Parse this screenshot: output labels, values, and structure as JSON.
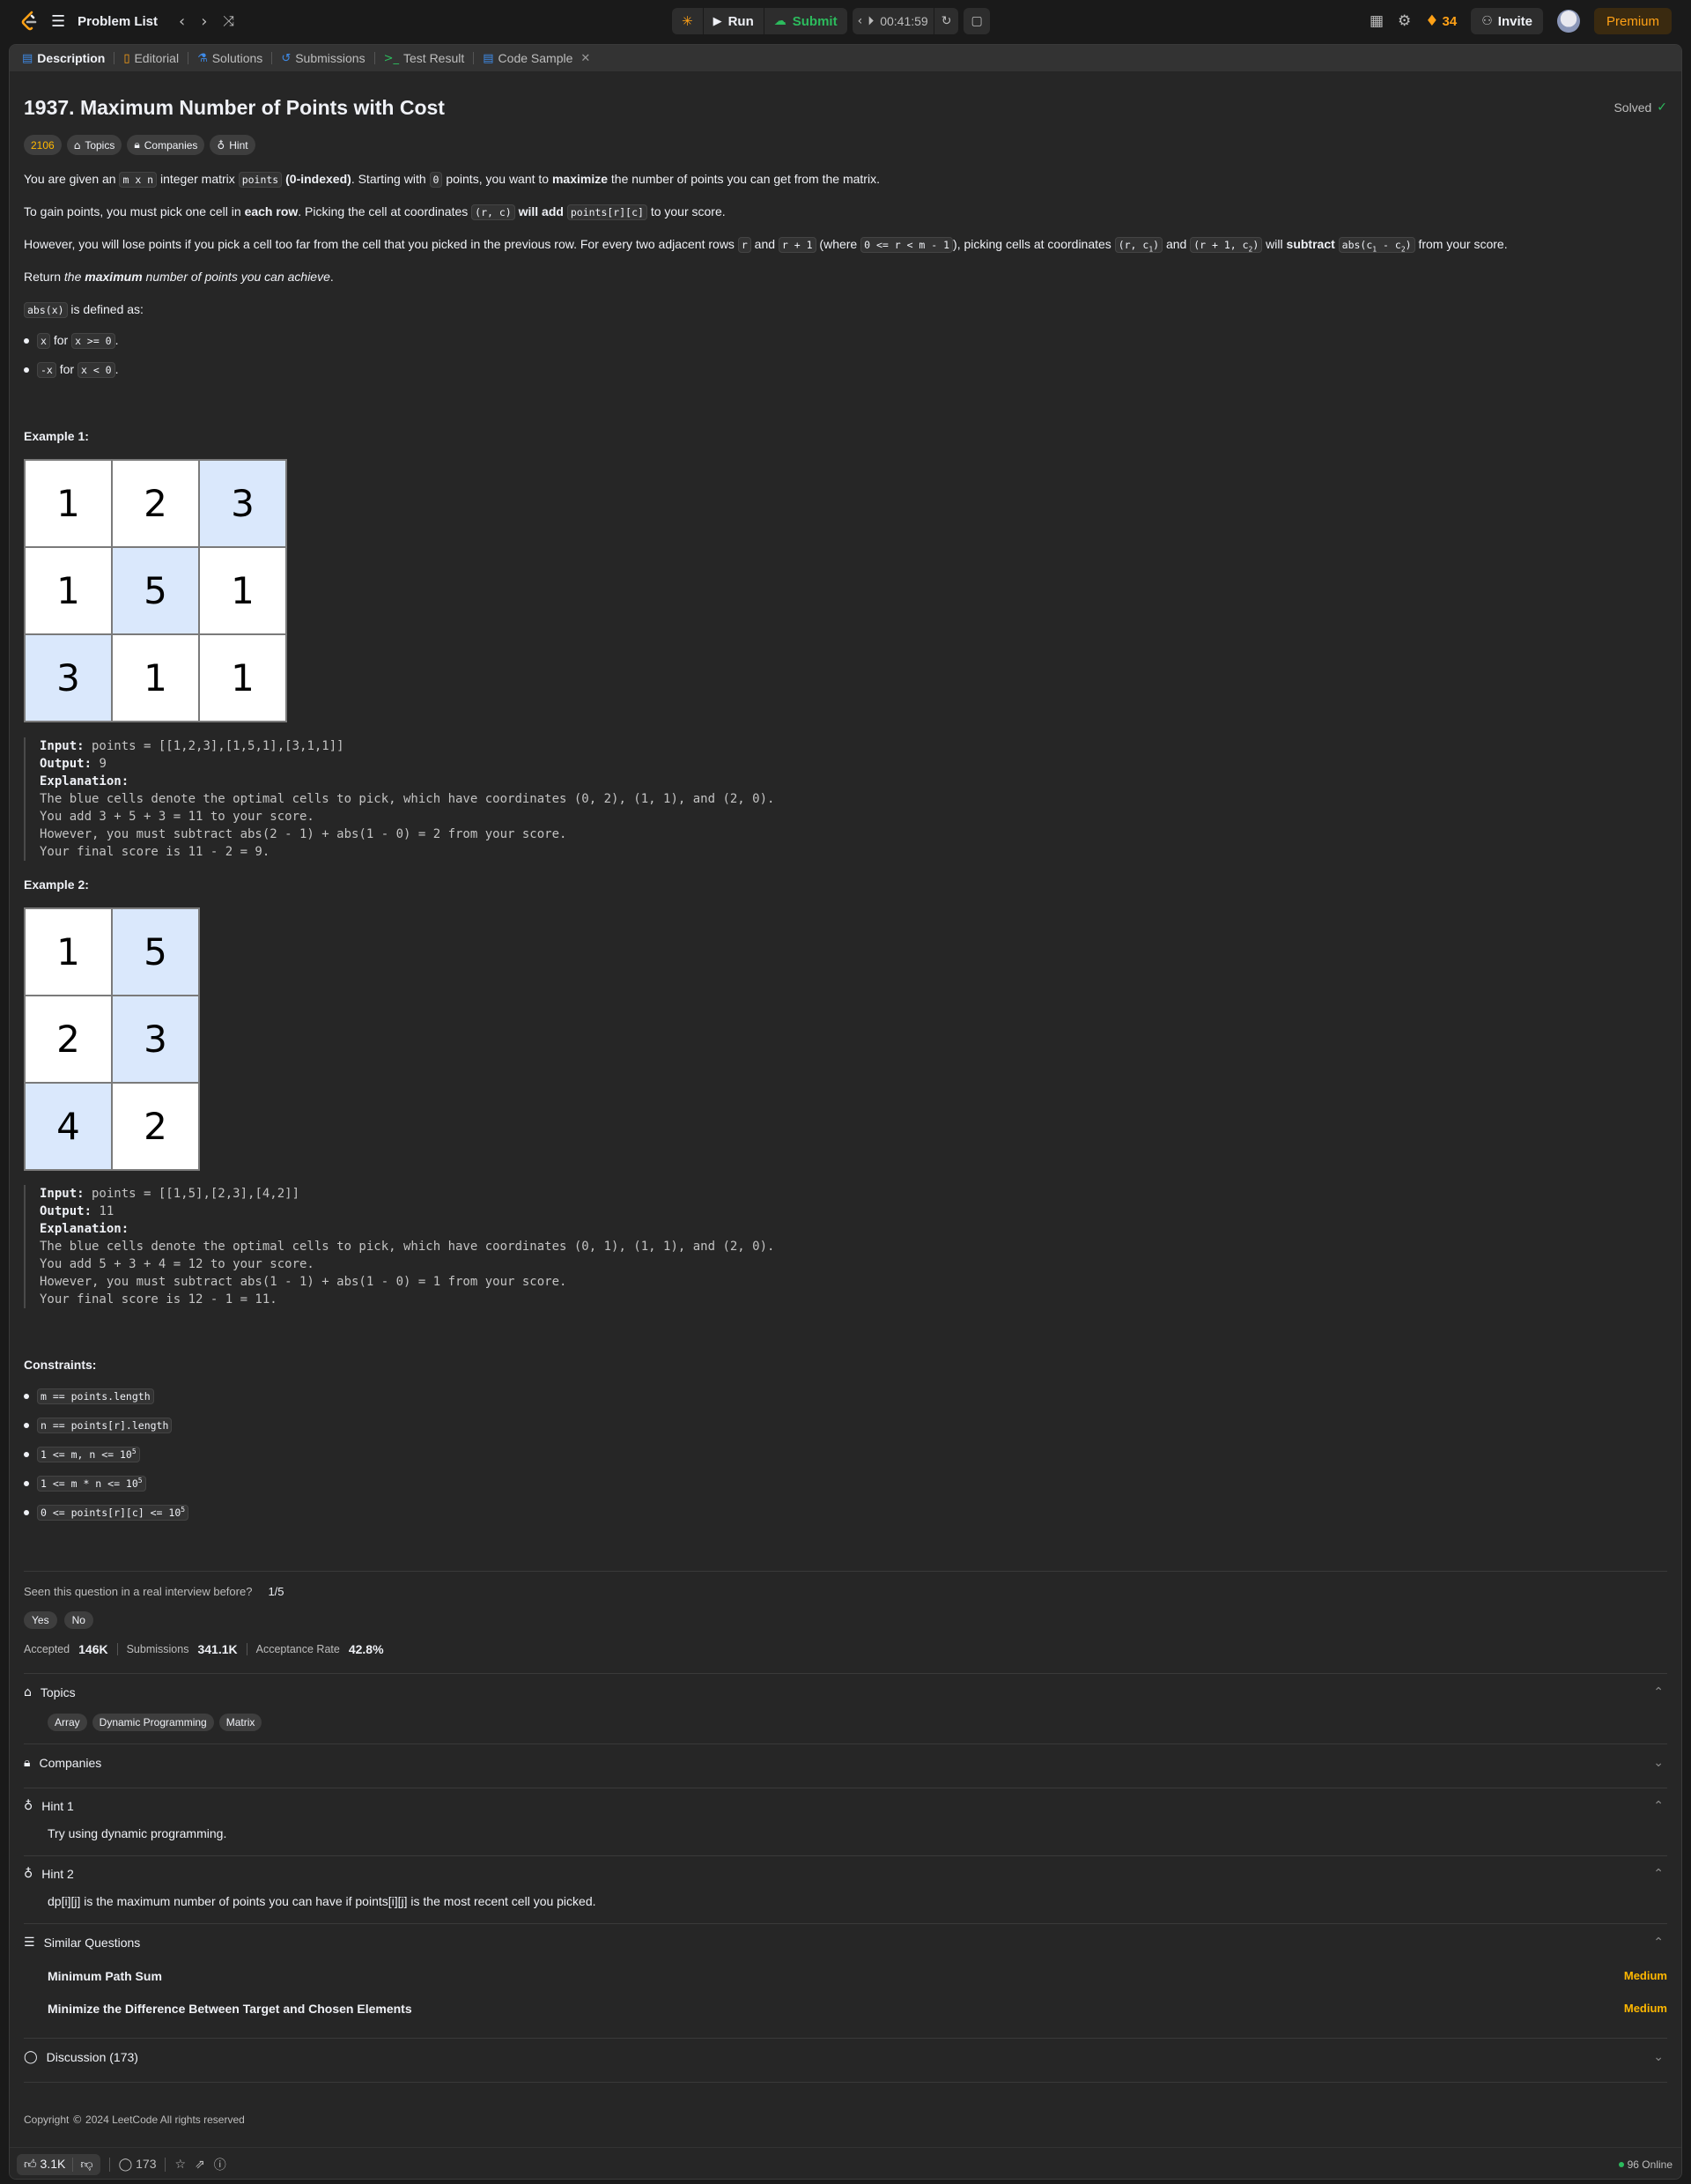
{
  "topbar": {
    "problem_list_label": "Problem List",
    "run_label": "Run",
    "submit_label": "Submit",
    "timer": "00:41:59",
    "streak": "34",
    "invite_label": "Invite",
    "premium_label": "Premium"
  },
  "tabs": [
    {
      "label": "Description"
    },
    {
      "label": "Editorial"
    },
    {
      "label": "Solutions"
    },
    {
      "label": "Submissions"
    },
    {
      "label": "Test Result"
    },
    {
      "label": "Code Sample"
    }
  ],
  "problem": {
    "title": "1937. Maximum Number of Points with Cost",
    "status": "Solved",
    "rating": "2106",
    "chip_topics": "Topics",
    "chip_companies": "Companies",
    "chip_hint": "Hint"
  },
  "desc": {
    "p1_a": "You are given an ",
    "p1_code1": "m x n",
    "p1_b": " integer matrix ",
    "p1_code2": "points",
    "p1_c": " ",
    "p1_bold1": "(0-indexed)",
    "p1_d": ". Starting with ",
    "p1_code3": "0",
    "p1_e": " points, you want to ",
    "p1_bold2": "maximize",
    "p1_f": " the number of points you can get from the matrix.",
    "p2_a": "To gain points, you must pick one cell in ",
    "p2_bold1": "each row",
    "p2_b": ". Picking the cell at coordinates ",
    "p2_code1": "(r, c)",
    "p2_c": " ",
    "p2_bold2": "will add",
    "p2_d": " ",
    "p2_code2": "points[r][c]",
    "p2_e": " to your score.",
    "p3_a": "However, you will lose points if you pick a cell too far from the cell that you picked in the previous row. For every two adjacent rows ",
    "p3_code1": "r",
    "p3_b": " and ",
    "p3_code2": "r + 1",
    "p3_c": " (where ",
    "p3_code3": "0 <= r < m - 1",
    "p3_d": "), picking cells at coordinates ",
    "p3_code4": "(r, c",
    "p3_code4_sub": "1",
    "p3_code4_end": ")",
    "p3_e": " and ",
    "p3_code5": "(r + 1, c",
    "p3_code5_sub": "2",
    "p3_code5_end": ")",
    "p3_f": " will ",
    "p3_bold": "subtract",
    "p3_g": " ",
    "p3_code6": "abs(c",
    "p3_code6_sub1": "1",
    "p3_code6_mid": " - c",
    "p3_code6_sub2": "2",
    "p3_code6_end": ")",
    "p3_h": " from your score.",
    "p4_a": "Return ",
    "p4_i1": "the ",
    "p4_bi": "maximum",
    "p4_i2": " number of points you can achieve",
    "p4_b": ".",
    "p5_code": "abs(x)",
    "p5_a": " is defined as:",
    "b1_code1": "x",
    "b1_a": " for ",
    "b1_code2": "x >= 0",
    "b1_b": ".",
    "b2_code1": "-x",
    "b2_a": " for ",
    "b2_code2": "x < 0",
    "b2_b": "."
  },
  "example1": {
    "heading": "Example 1:",
    "grid": [
      [
        "1",
        "2",
        "3"
      ],
      [
        "1",
        "5",
        "1"
      ],
      [
        "3",
        "1",
        "1"
      ]
    ],
    "input_label": "Input:",
    "input_val": " points = [[1,2,3],[1,5,1],[3,1,1]]",
    "output_label": "Output:",
    "output_val": " 9",
    "expl_label": "Explanation:",
    "expl_lines": [
      "The blue cells denote the optimal cells to pick, which have coordinates (0, 2), (1, 1), and (2, 0).",
      "You add 3 + 5 + 3 = 11 to your score.",
      "However, you must subtract abs(2 - 1) + abs(1 - 0) = 2 from your score.",
      "Your final score is 11 - 2 = 9."
    ]
  },
  "example2": {
    "heading": "Example 2:",
    "grid": [
      [
        "1",
        "5"
      ],
      [
        "2",
        "3"
      ],
      [
        "4",
        "2"
      ]
    ],
    "input_label": "Input:",
    "input_val": " points = [[1,5],[2,3],[4,2]]",
    "output_label": "Output:",
    "output_val": " 11",
    "expl_label": "Explanation:",
    "expl_lines": [
      "The blue cells denote the optimal cells to pick, which have coordinates (0, 1), (1, 1), and (2, 0).",
      "You add 5 + 3 + 4 = 12 to your score.",
      "However, you must subtract abs(1 - 1) + abs(1 - 0) = 1 from your score.",
      "Your final score is 12 - 1 = 11."
    ]
  },
  "constraints": {
    "heading": "Constraints:",
    "c1": "m == points.length",
    "c2": "n == points[r].length",
    "c3": "1 <= m, n <= 10",
    "c3_sup": "5",
    "c4": "1 <= m * n <= 10",
    "c4_sup": "5",
    "c5": "0 <= points[r][c] <= 10",
    "c5_sup": "5"
  },
  "interview": {
    "question": "Seen this question in a real interview before?",
    "count": "1/5",
    "yes": "Yes",
    "no": "No"
  },
  "stats": {
    "accepted_label": "Accepted",
    "accepted_val": "146K",
    "submissions_label": "Submissions",
    "submissions_val": "341.1K",
    "rate_label": "Acceptance Rate",
    "rate_val": "42.8%"
  },
  "sections": {
    "topics": "Topics",
    "topic_tags": [
      "Array",
      "Dynamic Programming",
      "Matrix"
    ],
    "companies": "Companies",
    "hint1": "Hint 1",
    "hint1_text": "Try using dynamic programming.",
    "hint2": "Hint 2",
    "hint2_text": "dp[i][j] is the maximum number of points you can have if points[i][j] is the most recent cell you picked.",
    "similar": "Similar Questions",
    "similar_items": [
      {
        "title": "Minimum Path Sum",
        "difficulty": "Medium"
      },
      {
        "title": "Minimize the Difference Between Target and Chosen Elements",
        "difficulty": "Medium"
      }
    ],
    "discussion": "Discussion (173)"
  },
  "footer": {
    "copyright_a": "Copyright",
    "copyright_b": "2024 LeetCode All rights reserved"
  },
  "bottombar": {
    "likes": "3.1K",
    "comments": "173",
    "online": "96 Online"
  },
  "colors": {
    "accent_green": "#2cbb5d",
    "accent_orange": "#ffa116",
    "medium": "#ffb800",
    "highlight_cell": "#dae8fc"
  },
  "icons": [
    "logo-icon",
    "list-icon",
    "chevron-left-icon",
    "chevron-right-icon",
    "shuffle-icon",
    "debug-icon",
    "play-icon",
    "cloud-upload-icon",
    "timer-icon",
    "reset-icon",
    "note-icon",
    "layout-icon",
    "gear-icon",
    "fire-icon",
    "user-plus-icon",
    "tag-icon",
    "lock-icon",
    "bulb-icon",
    "check-circle-icon",
    "thumbs-up-icon",
    "thumbs-down-icon",
    "comment-icon",
    "star-icon",
    "share-icon",
    "help-icon",
    "close-icon",
    "chevron-up-icon",
    "chevron-down-icon"
  ]
}
